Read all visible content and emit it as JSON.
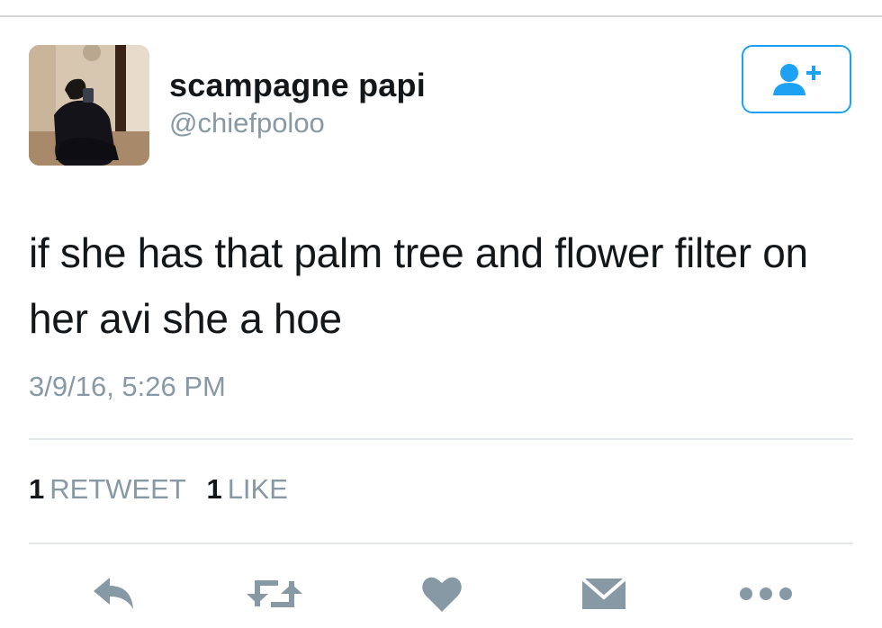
{
  "tweet": {
    "author": {
      "display_name": "scampagne papi",
      "handle": "@chiefpoloo"
    },
    "follow_button": {
      "icon": "add-user-icon",
      "color": "#1da1f2"
    },
    "text": "if she has that palm tree and flower filter on her avi she a hoe",
    "timestamp": "3/9/16, 5:26 PM",
    "stats": {
      "retweet_count": "1",
      "retweet_label": "RETWEET",
      "like_count": "1",
      "like_label": "LIKE"
    },
    "actions": [
      {
        "name": "reply",
        "icon": "reply-icon"
      },
      {
        "name": "retweet",
        "icon": "retweet-icon"
      },
      {
        "name": "like",
        "icon": "heart-icon"
      },
      {
        "name": "direct-message",
        "icon": "envelope-icon"
      },
      {
        "name": "more",
        "icon": "more-icon"
      }
    ]
  },
  "colors": {
    "text": "#14171a",
    "secondary": "#8899a6",
    "accent": "#1da1f2",
    "divider": "#e1e8ed"
  }
}
